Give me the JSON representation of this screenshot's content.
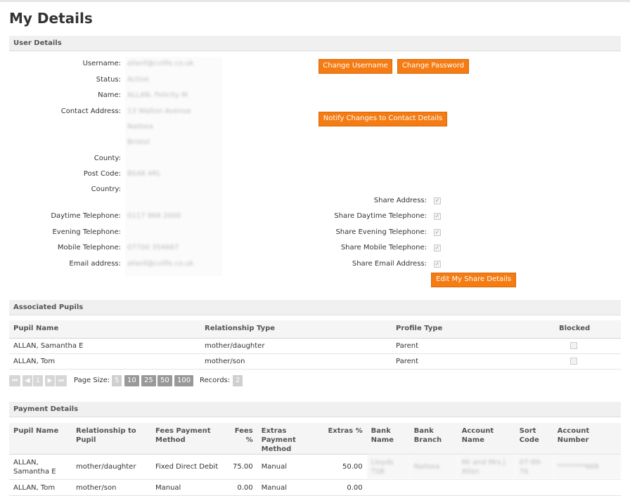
{
  "page": {
    "title": "My Details"
  },
  "user_details": {
    "section_title": "User Details",
    "fields": [
      {
        "label": "Username:",
        "value": "allanf@cvlife.co.uk"
      },
      {
        "label": "Status:",
        "value": "Active"
      },
      {
        "label": "Name:",
        "value": "ALLAN, Felicity M"
      },
      {
        "label": "Contact Address:",
        "value": "13 Walton Avenue"
      },
      {
        "label": "",
        "value": "Nailsea"
      },
      {
        "label": "",
        "value": "Bristol"
      },
      {
        "label": "County:",
        "value": ""
      },
      {
        "label": "Post Code:",
        "value": "BS48 4RL"
      },
      {
        "label": "Country:",
        "value": ""
      },
      {
        "label": "Daytime Telephone:",
        "value": "0117 968 2000"
      },
      {
        "label": "Evening Telephone:",
        "value": ""
      },
      {
        "label": "Mobile Telephone:",
        "value": "07700 354667"
      },
      {
        "label": "Email address:",
        "value": "allanf@cvlife.co.uk"
      }
    ],
    "share": [
      {
        "label": "Share Address:",
        "checked": true
      },
      {
        "label": "Share Daytime Telephone:",
        "checked": true
      },
      {
        "label": "Share Evening Telephone:",
        "checked": true
      },
      {
        "label": "Share Mobile Telephone:",
        "checked": true
      },
      {
        "label": "Share Email Address:",
        "checked": true
      }
    ],
    "buttons": {
      "change_username": "Change Username",
      "change_password": "Change Password",
      "notify_changes": "Notify Changes to Contact Details",
      "edit_share": "Edit My Share Details"
    },
    "check_glyph": "✓"
  },
  "associated_pupils": {
    "section_title": "Associated Pupils",
    "columns": [
      "Pupil Name",
      "Relationship Type",
      "Profile Type",
      "Blocked"
    ],
    "rows": [
      {
        "name": "ALLAN, Samantha E",
        "relationship": "mother/daughter",
        "profile": "Parent",
        "blocked": false
      },
      {
        "name": "ALLAN, Tom",
        "relationship": "mother/son",
        "profile": "Parent",
        "blocked": false
      }
    ],
    "pager": {
      "first": "⏮",
      "prev": "◀",
      "current_page": "1",
      "next": "▶",
      "last": "⏭",
      "page_size_label": "Page Size:",
      "page_sizes": [
        "5",
        "10",
        "25",
        "50",
        "100"
      ],
      "records_label": "Records:",
      "records": "2"
    }
  },
  "payment_details": {
    "section_title": "Payment Details",
    "columns": {
      "pupil_name": "Pupil Name",
      "relationship": "Relationship to Pupil",
      "fees_method": "Fees Payment Method",
      "fees_pct": "Fees %",
      "extras_method": "Extras Payment Method",
      "extras_pct": "Extras %",
      "bank_name": "Bank Name",
      "bank_branch": "Bank Branch",
      "account_name": "Account Name",
      "sort_code": "Sort Code",
      "account_number": "Account Number"
    },
    "rows": [
      {
        "name": "ALLAN, Samantha E",
        "relationship": "mother/daughter",
        "fees_method": "Fixed Direct Debit",
        "fees_pct": "75.00",
        "extras_method": "Manual",
        "extras_pct": "50.00",
        "bank_name": "Lloyds TSB",
        "bank_branch": "Nailsea",
        "account_name": "Mr and Mrs J Allan",
        "sort_code": "07-99-76",
        "account_number": "********668"
      },
      {
        "name": "ALLAN, Tom",
        "relationship": "mother/son",
        "fees_method": "Manual",
        "fees_pct": "0.00",
        "extras_method": "Manual",
        "extras_pct": "0.00",
        "bank_name": "",
        "bank_branch": "",
        "account_name": "",
        "sort_code": "",
        "account_number": ""
      }
    ]
  }
}
